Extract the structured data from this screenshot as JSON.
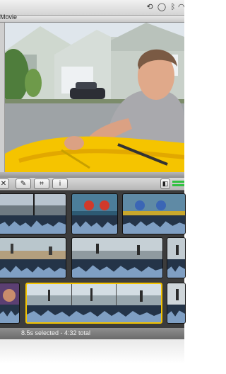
{
  "window": {
    "title": "Movie"
  },
  "menubar": {
    "icons": [
      "time-machine-icon",
      "chat-icon",
      "bluetooth-icon",
      "wifi-icon"
    ]
  },
  "toolbar": {
    "buttons": [
      {
        "name": "reject-button",
        "glyph": "✕"
      },
      {
        "name": "eyedropper-button",
        "glyph": "✎"
      },
      {
        "name": "crop-button",
        "glyph": "⌗"
      },
      {
        "name": "info-button",
        "glyph": "i"
      }
    ],
    "audio_toggle_glyph": "◧"
  },
  "status": {
    "text": "8.5s selected - 4:32 total"
  },
  "colors": {
    "accent_selected": "#f5c400",
    "waveform": "#7f9fc3",
    "browser_bg": "#3c3c3c"
  }
}
